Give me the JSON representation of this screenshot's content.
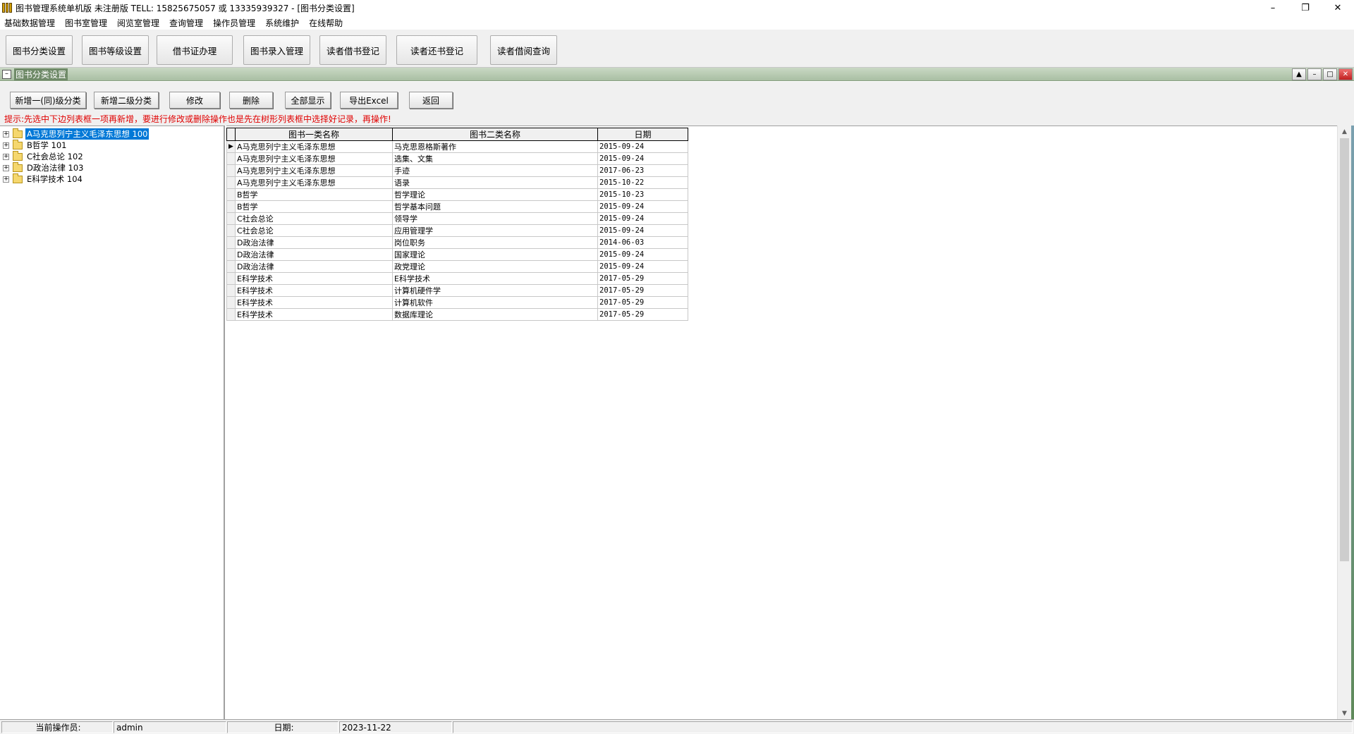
{
  "window": {
    "title": "图书管理系统单机版 未注册版 TELL: 15825675057 或 13335939327 - [图书分类设置]",
    "controls": [
      "–",
      "❐",
      "✕"
    ]
  },
  "menu": [
    "基础数据管理",
    "图书室管理",
    "阅览室管理",
    "查询管理",
    "操作员管理",
    "系统维护",
    "在线帮助"
  ],
  "toolbar": [
    "图书分类设置",
    "图书等级设置",
    "借书证办理",
    "图书录入管理",
    "读者借书登记",
    "读者还书登记",
    "读者借阅查询"
  ],
  "child_window": {
    "title": "图书分类设置",
    "controls": [
      "▲",
      "–",
      "□",
      "✕"
    ]
  },
  "actions": [
    "新增一(同)级分类",
    "新增二级分类",
    "修改",
    "删除",
    "全部显示",
    "导出Excel",
    "返回"
  ],
  "hint": "提示:先选中下边列表框一项再新增，要进行修改或删除操作也是先在树形列表框中选择好记录，再操作!",
  "tree": [
    {
      "label": "A马克思列宁主义毛泽东思想  100",
      "selected": true
    },
    {
      "label": "B哲学  101",
      "selected": false
    },
    {
      "label": "C社会总论  102",
      "selected": false
    },
    {
      "label": "D政治法律  103",
      "selected": false
    },
    {
      "label": "E科学技术  104",
      "selected": false
    }
  ],
  "grid": {
    "columns": [
      "图书一类名称",
      "图书二类名称",
      "日期"
    ],
    "current_row_marker": "▶",
    "rows": [
      [
        "A马克思列宁主义毛泽东思想",
        "马克思恩格斯著作",
        "2015-09-24"
      ],
      [
        "A马克思列宁主义毛泽东思想",
        "选集、文集",
        "2015-09-24"
      ],
      [
        "A马克思列宁主义毛泽东思想",
        "手迹",
        "2017-06-23"
      ],
      [
        "A马克思列宁主义毛泽东思想",
        "语录",
        "2015-10-22"
      ],
      [
        "B哲学",
        "哲学理论",
        "2015-10-23"
      ],
      [
        "B哲学",
        "哲学基本问题",
        "2015-09-24"
      ],
      [
        "C社会总论",
        "领导学",
        "2015-09-24"
      ],
      [
        "C社会总论",
        "应用管理学",
        "2015-09-24"
      ],
      [
        "D政治法律",
        "岗位职务",
        "2014-06-03"
      ],
      [
        "D政治法律",
        "国家理论",
        "2015-09-24"
      ],
      [
        "D政治法律",
        "政党理论",
        "2015-09-24"
      ],
      [
        "E科学技术",
        "E科学技术",
        "2017-05-29"
      ],
      [
        "E科学技术",
        "计算机硬件学",
        "2017-05-29"
      ],
      [
        "E科学技术",
        "计算机软件",
        "2017-05-29"
      ],
      [
        "E科学技术",
        "数据库理论",
        "2017-05-29"
      ]
    ]
  },
  "status": {
    "operator_label": "当前操作员:",
    "operator": "admin",
    "date_label": "日期:",
    "date": "2023-11-22"
  }
}
